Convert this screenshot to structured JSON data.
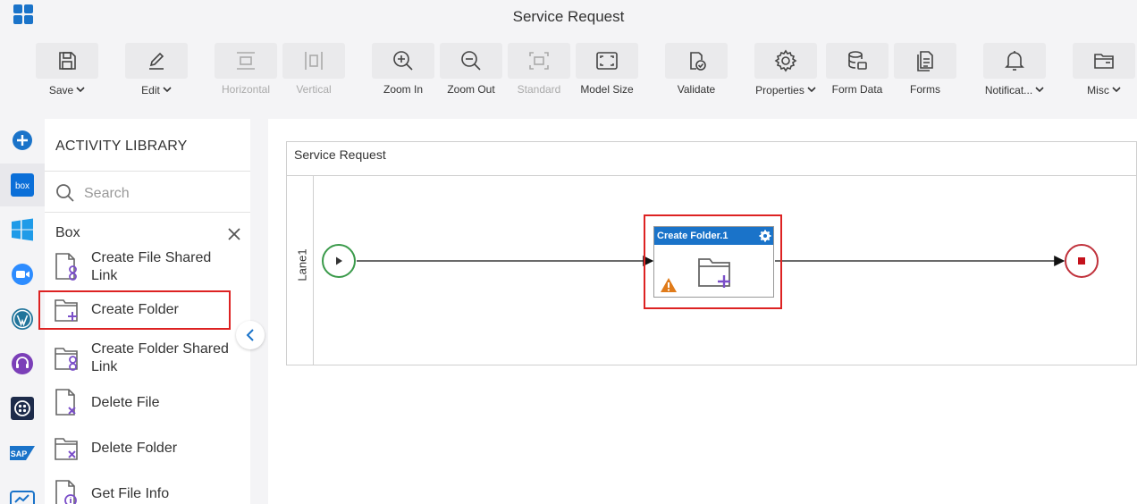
{
  "window": {
    "title": "Service Request"
  },
  "toolbar": {
    "items": [
      {
        "label": "Save",
        "icon": "save-icon",
        "dropdown": true,
        "disabled": false
      },
      {
        "label": "Edit",
        "icon": "edit-icon",
        "dropdown": true,
        "disabled": false
      },
      {
        "label": "Horizontal",
        "icon": "horizontal-icon",
        "dropdown": false,
        "disabled": true
      },
      {
        "label": "Vertical",
        "icon": "vertical-icon",
        "dropdown": false,
        "disabled": true
      },
      {
        "label": "Zoom In",
        "icon": "zoom-in-icon",
        "dropdown": false,
        "disabled": false
      },
      {
        "label": "Zoom Out",
        "icon": "zoom-out-icon",
        "dropdown": false,
        "disabled": false
      },
      {
        "label": "Standard",
        "icon": "standard-icon",
        "dropdown": false,
        "disabled": true
      },
      {
        "label": "Model Size",
        "icon": "model-size-icon",
        "dropdown": false,
        "disabled": false
      },
      {
        "label": "Validate",
        "icon": "validate-icon",
        "dropdown": false,
        "disabled": false
      },
      {
        "label": "Properties",
        "icon": "gear-icon",
        "dropdown": true,
        "disabled": false
      },
      {
        "label": "Form Data",
        "icon": "database-icon",
        "dropdown": false,
        "disabled": false
      },
      {
        "label": "Forms",
        "icon": "forms-icon",
        "dropdown": false,
        "disabled": false
      },
      {
        "label": "Notificat...",
        "icon": "bell-icon",
        "dropdown": true,
        "disabled": false
      },
      {
        "label": "Misc",
        "icon": "folder-icon",
        "dropdown": true,
        "disabled": false
      }
    ]
  },
  "rail": {
    "items": [
      {
        "icon": "add-icon"
      },
      {
        "icon": "box-icon",
        "text": "box",
        "active": true
      },
      {
        "icon": "windows-icon"
      },
      {
        "icon": "zoom-app-icon"
      },
      {
        "icon": "wordpress-icon"
      },
      {
        "icon": "support-icon"
      },
      {
        "icon": "twilio-icon"
      },
      {
        "icon": "sap-icon",
        "text": "SAP"
      },
      {
        "icon": "app-icon"
      }
    ]
  },
  "library": {
    "heading": "ACTIVITY LIBRARY",
    "search_placeholder": "Search",
    "category": "Box",
    "items": [
      {
        "label": "Create File Shared Link",
        "icon": "file-link-icon"
      },
      {
        "label": "Create Folder",
        "icon": "folder-add-icon",
        "highlighted": true
      },
      {
        "label": "Create Folder Shared Link",
        "icon": "folder-link-icon"
      },
      {
        "label": "Delete File",
        "icon": "file-delete-icon"
      },
      {
        "label": "Delete Folder",
        "icon": "folder-delete-icon"
      },
      {
        "label": "Get File Info",
        "icon": "file-info-icon"
      }
    ]
  },
  "canvas": {
    "pool_title": "Service Request",
    "lane_label": "Lane1",
    "task": {
      "title": "Create Folder.1",
      "icon": "folder-add-icon",
      "warning": true
    }
  },
  "colors": {
    "accent": "#1a73c9",
    "highlight": "#d22222",
    "start": "#3a9a4a",
    "end": "#c0313b",
    "icon_purple": "#7b4fc9",
    "warning": "#e07b1a"
  }
}
